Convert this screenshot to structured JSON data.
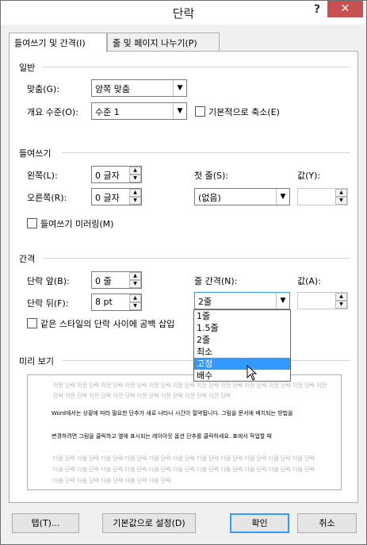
{
  "window": {
    "title": "단락",
    "help": "?",
    "close": "✕"
  },
  "tabs": [
    {
      "label": "들여쓰기 및 간격(I)"
    },
    {
      "label": "줄 및 페이지 나누기(P)"
    }
  ],
  "general": {
    "heading": "일반",
    "alignment_label": "맞춤(G):",
    "alignment_value": "양쪽 맞춤",
    "outline_label": "개요 수준(O):",
    "outline_value": "수준 1",
    "collapsed_label": "기본적으로 축소(E)"
  },
  "indentation": {
    "heading": "들여쓰기",
    "left_label": "왼쪽(L):",
    "left_value": "0 글자",
    "right_label": "오른쪽(R):",
    "right_value": "0 글자",
    "special_label": "첫 줄(S):",
    "special_value": "(없음)",
    "by_label": "값(Y):",
    "by_value": "",
    "mirror_label": "들여쓰기 미러링(M)"
  },
  "spacing": {
    "heading": "간격",
    "before_label": "단락 앞(B):",
    "before_value": "0 줄",
    "after_label": "단락 뒤(F):",
    "after_value": "8 pt",
    "line_spacing_label": "줄 간격(N):",
    "line_spacing_value": "2줄",
    "at_label": "값(A):",
    "at_value": "",
    "dont_add_label": "같은 스타일의 단락 사이에 공백 삽입"
  },
  "line_spacing_options": [
    "1줄",
    "1.5줄",
    "2줄",
    "최소",
    "고정",
    "배수"
  ],
  "line_spacing_highlighted": "고정",
  "preview": {
    "heading": "미리 보기",
    "prev_lines": [
      "이전 단락 이전 단락 이전 단락 이전 단락 이전 단락 이전 단락 이전 단락 이전 단락 이전 단락 이전 단락 이전 단락 이전",
      "단락 이전 단락 이전 단락 이전 단락 이전 단락 이전 단락 이전 단락 이전 단락"
    ],
    "body_lines": [
      "Word에서는 상황에 따라 필요한 단추가 새로 나타나 시간이 절약됩니다. 그림을 문서에 배치되는 방법을",
      "변경하려면 그림을 클릭하고 옆에 표시되는 레이아웃 옵션 단추를 클릭하세요. 표에서 작업할 때"
    ],
    "next_lines": [
      "다음 단락 다음 단락 다음 단락 다음 단락 다음 단락 다음 단락 다음 단락 다음 단락 다음 단락 다음 단락 다음 단락",
      "다음 단락 다음 단락 다음 단락 다음 단락 다음 단락 다음 단락 다음 단락 다음 단락 다음 단락 다음 단락 다음 단락",
      "다음 단락 다음 단락 다음 단락 다음 단락 다음 단락"
    ]
  },
  "buttons": {
    "tabs": "탭(T)...",
    "set_default": "기본값으로 설정(D)",
    "ok": "확인",
    "cancel": "취소"
  },
  "colors": {
    "highlight": "#3399ff",
    "close": "#c75050"
  }
}
